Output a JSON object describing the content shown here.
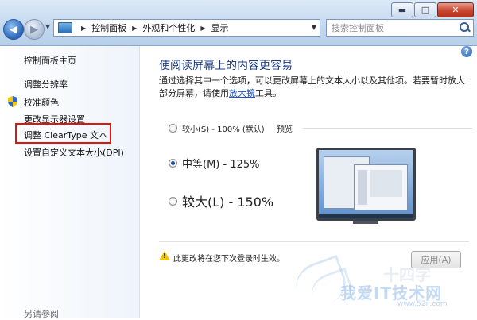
{
  "window": {
    "minimize": "▬",
    "maximize": "□",
    "close": "✕"
  },
  "nav": {
    "back": "◀",
    "forward": "▶"
  },
  "address": {
    "crumbs": [
      "控制面板",
      "外观和个性化",
      "显示"
    ]
  },
  "search": {
    "placeholder": "搜索控制面板"
  },
  "sidebar": {
    "items": [
      {
        "label": "控制面板主页"
      },
      {
        "label": "调整分辨率"
      },
      {
        "label": "校准颜色",
        "icon": "shield-icon"
      },
      {
        "label": "更改显示器设置"
      },
      {
        "label": "调整 ClearType 文本",
        "highlighted": true
      },
      {
        "label": "设置自定义文本大小(DPI)"
      }
    ],
    "see_also": "另请参阅"
  },
  "main": {
    "help": "?",
    "title": "使阅读屏幕上的内容更容易",
    "description_pre": "通过选择其中一个选项，可以更改屏幕上的文本大小以及其他项。若要暂时放大部分屏幕，请使用",
    "description_link": "放大镜",
    "description_post": "工具。",
    "options": [
      {
        "label": "较小(S) - 100% (默认)",
        "checked": false
      },
      {
        "label": "中等(M) - 125%",
        "checked": true
      },
      {
        "label": "较大(L) - 150%",
        "checked": false
      }
    ],
    "preview_label": "预览",
    "warning": "此更改将在您下次登录时生效。",
    "apply_label": "应用(A)"
  },
  "watermark": {
    "main": "我爱IT技术网",
    "sub": "www.52ij.com",
    "ghost": "十四字"
  }
}
